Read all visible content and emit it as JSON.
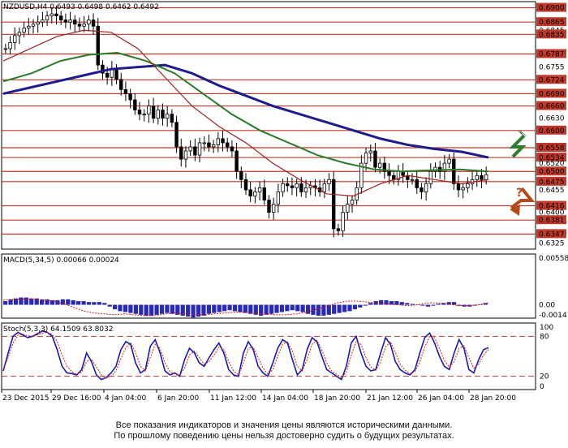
{
  "chart_data": [
    {
      "type": "candlestick",
      "title": "NZDUSD,H4  0.6493 0.6498 0.6462 0.6492",
      "ylim": [
        0.631,
        0.6915
      ],
      "price_ticks": [
        "0.6900",
        "0.6865",
        "0.6845",
        "0.6835",
        "0.6787",
        "0.6755",
        "0.6724",
        "0.6690",
        "0.6660",
        "0.6630",
        "0.6600",
        "0.6558",
        "0.6534",
        "0.6520",
        "0.6500",
        "0.6475",
        "0.6455",
        "0.6416",
        "0.6400",
        "0.6381",
        "0.6347",
        "0.6325"
      ],
      "resistance_levels": [
        0.69,
        0.6865,
        0.6835,
        0.6787,
        0.6724,
        0.669,
        0.666,
        0.66,
        0.6558,
        0.6534
      ],
      "support_levels": [
        0.65,
        0.6475,
        0.6416,
        0.6381,
        0.6347
      ],
      "highlighted_labels": [
        "0.6900",
        "0.6865",
        "0.6835",
        "0.6787",
        "0.6724",
        "0.6690",
        "0.6660",
        "0.6600",
        "0.6558",
        "0.6534",
        "0.6500",
        "0.6475",
        "0.6416",
        "0.6381",
        "0.6347"
      ],
      "close_series": [
        0.68,
        0.6815,
        0.6832,
        0.684,
        0.685,
        0.6855,
        0.686,
        0.6865,
        0.687,
        0.688,
        0.6885,
        0.688,
        0.687,
        0.6865,
        0.687,
        0.686,
        0.6855,
        0.686,
        0.687,
        0.6855,
        0.676,
        0.674,
        0.673,
        0.675,
        0.6725,
        0.67,
        0.669,
        0.6675,
        0.665,
        0.664,
        0.664,
        0.666,
        0.663,
        0.665,
        0.663,
        0.664,
        0.662,
        0.656,
        0.653,
        0.655,
        0.656,
        0.654,
        0.657,
        0.657,
        0.656,
        0.6565,
        0.658,
        0.657,
        0.656,
        0.655,
        0.65,
        0.648,
        0.6455,
        0.644,
        0.645,
        0.646,
        0.643,
        0.64,
        0.642,
        0.645,
        0.647,
        0.6465,
        0.646,
        0.647,
        0.645,
        0.646,
        0.6465,
        0.646,
        0.645,
        0.647,
        0.648,
        0.636,
        0.6355,
        0.64,
        0.642,
        0.643,
        0.646,
        0.652,
        0.6545,
        0.655,
        0.651,
        0.652,
        0.65,
        0.649,
        0.648,
        0.65,
        0.649,
        0.648,
        0.648,
        0.646,
        0.645,
        0.647,
        0.65,
        0.651,
        0.65,
        0.652,
        0.653,
        0.647,
        0.6455,
        0.646,
        0.647,
        0.648,
        0.649,
        0.648,
        0.6492
      ],
      "ma_series": [
        {
          "color": "#1c1c8c",
          "values": [
            0.669,
            0.6705,
            0.672,
            0.6735,
            0.675,
            0.6755,
            0.676,
            0.674,
            0.671,
            0.6685,
            0.666,
            0.664,
            0.662,
            0.66,
            0.658,
            0.6565,
            0.6555,
            0.6548,
            0.6534
          ]
        },
        {
          "color": "#2a7a2a",
          "values": [
            0.672,
            0.674,
            0.677,
            0.6785,
            0.679,
            0.677,
            0.674,
            0.669,
            0.664,
            0.66,
            0.657,
            0.654,
            0.652,
            0.6505,
            0.65,
            0.6503,
            0.6505,
            0.65
          ]
        },
        {
          "color": "#a02020",
          "values": [
            0.677,
            0.68,
            0.683,
            0.6845,
            0.684,
            0.68,
            0.673,
            0.666,
            0.661,
            0.657,
            0.652,
            0.648,
            0.6445,
            0.644,
            0.647,
            0.649,
            0.648,
            0.647,
            0.648
          ]
        }
      ],
      "forecast_arrows": [
        {
          "direction": "up",
          "color": "#2f7d2f"
        },
        {
          "direction": "down",
          "color": "#b24a1a",
          "label": "?"
        }
      ]
    },
    {
      "type": "bar",
      "title": "MACD(5,34,5) 0.00066 0.00024",
      "ylim": [
        -0.00147,
        0.00558
      ],
      "y_ticks": [
        "0.00558",
        "0.00",
        "-0.00147"
      ],
      "histogram": [
        0.0004,
        0.0006,
        0.0007,
        0.0008,
        0.0008,
        0.0007,
        0.0007,
        0.0006,
        0.0006,
        0.0005,
        0.0005,
        0.0006,
        0.0006,
        0.0005,
        0.0004,
        0.0004,
        0.0003,
        0.0003,
        0.0003,
        0.0002,
        -0.0002,
        -0.0005,
        -0.0007,
        -0.0008,
        -0.0009,
        -0.001,
        -0.0011,
        -0.0012,
        -0.0012,
        -0.0011,
        -0.001,
        -0.0009,
        -0.001,
        -0.0011,
        -0.0012,
        -0.0013,
        -0.0014,
        -0.0013,
        -0.0012,
        -0.001,
        -0.0009,
        -0.0008,
        -0.0007,
        -0.0006,
        -0.0007,
        -0.0008,
        -0.0009,
        -0.001,
        -0.0011,
        -0.0012,
        -0.0011,
        -0.001,
        -0.0009,
        -0.0008,
        -0.0007,
        -0.0006,
        -0.0007,
        -0.0008,
        -0.001,
        -0.0011,
        -0.0012,
        -0.0012,
        -0.0011,
        -0.001,
        -0.0009,
        -0.0008,
        -0.0007,
        -0.0005,
        -0.0003,
        -0.0001,
        0.0002,
        0.0004,
        0.0005,
        0.0005,
        0.0004,
        0.0004,
        0.0003,
        0.0002,
        0.0001,
        0.0,
        -0.0001,
        -0.0002,
        -0.0001,
        0.0001,
        0.0002,
        0.0003,
        0.0003,
        -0.0001,
        -0.0002,
        -0.0002,
        -0.0001,
        0.0,
        0.0002
      ],
      "signal": [
        0.0005,
        0.0006,
        0.0006,
        0.0006,
        0.0005,
        0.0004,
        0.0001,
        -0.0003,
        -0.0007,
        -0.0009,
        -0.001,
        -0.0011,
        -0.001,
        -0.0011,
        -0.0012,
        -0.0012,
        -0.001,
        -0.0009,
        -0.001,
        -0.0011,
        -0.0011,
        -0.001,
        -0.0009,
        -0.0008,
        -0.0008,
        -0.0009,
        -0.001,
        -0.0011,
        -0.0011,
        -0.001,
        -0.0008,
        -0.0005,
        -0.0002,
        0.0002,
        0.0004,
        0.0004,
        0.0003,
        0.0002,
        0.0001,
        0.0,
        -0.0001,
        0.0,
        0.0002,
        0.0002,
        0.0001,
        -0.0001,
        -0.0001,
        0.0,
        0.0002
      ]
    },
    {
      "type": "line",
      "title": "Stoch(5,3,3) 64.1509 63.8032",
      "ylim": [
        0,
        100
      ],
      "y_ticks": [
        "100",
        "80",
        "20",
        "0"
      ],
      "levels": [
        80,
        20
      ],
      "series": [
        {
          "color": "#1a1aa8",
          "values": [
            28,
            55,
            80,
            86,
            82,
            78,
            80,
            84,
            88,
            86,
            80,
            60,
            35,
            25,
            24,
            22,
            30,
            55,
            42,
            22,
            15,
            18,
            25,
            35,
            60,
            72,
            68,
            40,
            25,
            30,
            65,
            75,
            55,
            28,
            22,
            25,
            20,
            45,
            62,
            55,
            40,
            35,
            48,
            60,
            70,
            55,
            30,
            22,
            20,
            55,
            72,
            60,
            35,
            25,
            20,
            40,
            62,
            75,
            70,
            45,
            22,
            30,
            60,
            78,
            72,
            50,
            30,
            25,
            20,
            15,
            35,
            70,
            80,
            55,
            35,
            28,
            30,
            55,
            78,
            68,
            42,
            30,
            25,
            22,
            30,
            55,
            78,
            85,
            70,
            50,
            35,
            30,
            55,
            75,
            62,
            30,
            25,
            45,
            60,
            63
          ]
        },
        {
          "color": "#d01818",
          "values": [
            30,
            48,
            70,
            82,
            83,
            81,
            80,
            82,
            85,
            86,
            83,
            72,
            52,
            35,
            27,
            23,
            26,
            42,
            46,
            34,
            22,
            17,
            20,
            28,
            46,
            63,
            70,
            56,
            35,
            28,
            48,
            68,
            62,
            40,
            27,
            24,
            22,
            32,
            52,
            58,
            48,
            38,
            42,
            52,
            64,
            60,
            42,
            28,
            22,
            40,
            62,
            64,
            48,
            32,
            23,
            30,
            50,
            68,
            72,
            58,
            35,
            28,
            45,
            68,
            74,
            60,
            40,
            28,
            23,
            18,
            26,
            52,
            72,
            68,
            48,
            34,
            29,
            42,
            64,
            72,
            56,
            38,
            29,
            24,
            27,
            42,
            64,
            80,
            78,
            62,
            44,
            34,
            42,
            62,
            66,
            48,
            32,
            38,
            52,
            60
          ]
        }
      ]
    }
  ],
  "x_labels": [
    "23 Dec 2015",
    "29 Dec 16:00",
    "4 Jan 04:00",
    "6 Jan 20:00",
    "11 Jan 12:00",
    "14 Jan 04:00",
    "18 Jan 20:00",
    "21 Jan 12:00",
    "26 Jan 04:00",
    "28 Jan 20:00"
  ],
  "disclaimer": [
    "Все показания индикаторов и значения цены являются историческими данными.",
    "По прошлому поведению цены нельзя достоверно судить о будущих результатах."
  ],
  "colors": {
    "level_line": "#c0392b",
    "label_bg": "#c0392b",
    "candle": "#000000",
    "macd_bar": "#2a2ab0"
  }
}
